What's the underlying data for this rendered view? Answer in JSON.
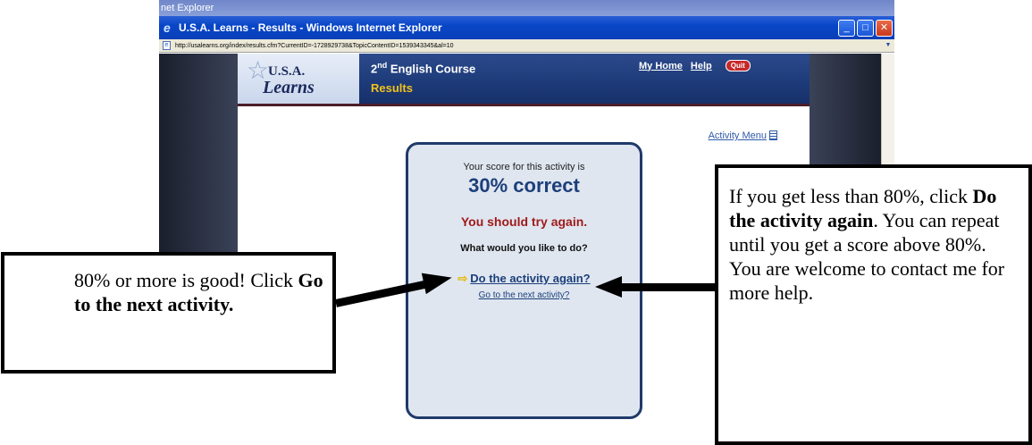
{
  "browser": {
    "outer_title": "net Explorer",
    "window_title": "U.S.A. Learns - Results - Windows Internet Explorer",
    "address": "http://usalearns.org/index/results.cfm?CurrentID=-1728929738&TopicContentID=1539343345&al=10",
    "icons": {
      "ie": "ie-e-icon",
      "page": "page-icon",
      "minimize": "minimize-icon",
      "maximize": "maximize-icon",
      "close": "close-icon"
    }
  },
  "site": {
    "logo_line1": "U.S.A.",
    "logo_line2": "Learns",
    "course_title": "2",
    "course_title_sup": "nd",
    "course_title_rest": " English Course",
    "section": "Results",
    "nav": {
      "home": "My Home",
      "help": "Help",
      "quit": "Quit"
    },
    "activity_menu": "Activity Menu"
  },
  "results": {
    "score_intro": "Your score for this activity is",
    "score_value": "30% correct",
    "feedback": "You should try again.",
    "prompt": "What would you like to do?",
    "do_again": "Do the activity again?",
    "next": "Go to the next activity?"
  },
  "annotations": {
    "left": {
      "t1": "80% or more is good! Click ",
      "b1": "Go to the next activity."
    },
    "right": {
      "t1": "If you get less than 80%, click ",
      "b1": "Do the activity again",
      "t2": ". You can repeat until you get a score above 80%. You are welcome to contact me for more help."
    }
  },
  "colors": {
    "banner": "#1d3a78",
    "section": "#f2c21a",
    "feedback": "#a01a1a",
    "score": "#1c3f7a"
  }
}
